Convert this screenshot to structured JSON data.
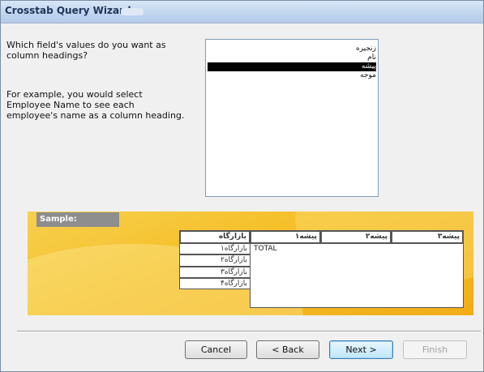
{
  "window": {
    "title": "Crosstab Query Wizard"
  },
  "instructions": {
    "question": "Which field's values do you want as\ncolumn headings?",
    "example": "For example, you would select\nEmployee Name to see each\nemployee's name as a column heading."
  },
  "fields": [
    {
      "label": "زنجیره",
      "selected": false
    },
    {
      "label": "نام",
      "selected": false
    },
    {
      "label": "پیشه",
      "selected": true
    },
    {
      "label": "موجه",
      "selected": false
    }
  ],
  "sample": {
    "label": "Sample:",
    "row_header": "بازارگاه",
    "column_headers": [
      "پیشه۱",
      "پیشه۲",
      "پیشه۳"
    ],
    "rows": [
      "بازارگاه۱",
      "بازارگاه۲",
      "بازارگاه۳",
      "بازارگاه۴"
    ],
    "cell_value": "TOTAL"
  },
  "buttons": {
    "cancel": "Cancel",
    "back": "< Back",
    "next": "Next >",
    "finish": "Finish"
  }
}
